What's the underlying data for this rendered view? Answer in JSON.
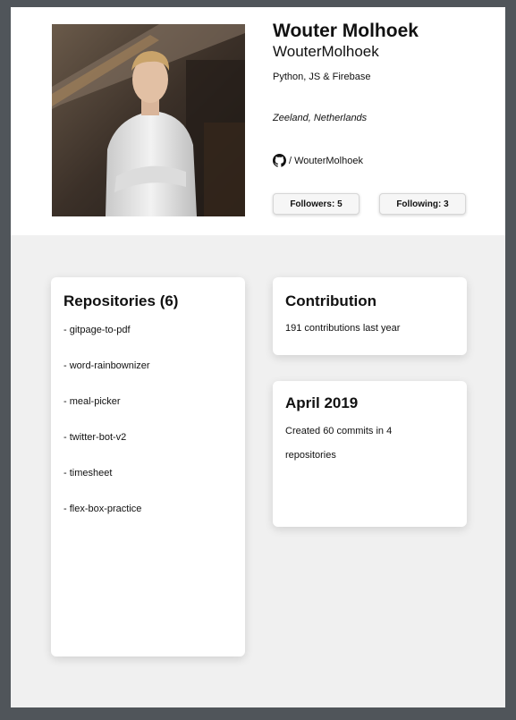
{
  "profile": {
    "name": "Wouter Molhoek",
    "username": "WouterMolhoek",
    "skills": "Python, JS & Firebase",
    "location": "Zeeland, Netherlands",
    "github_link": "/ WouterMolhoek",
    "followers_label": "Followers: 5",
    "following_label": "Following: 3"
  },
  "repositories": {
    "title": "Repositories (6)",
    "items": [
      "- gitpage-to-pdf",
      "- word-rainbownizer",
      "- meal-picker",
      "- twitter-bot-v2",
      "- timesheet",
      "- flex-box-practice"
    ]
  },
  "contribution": {
    "title": "Contribution",
    "text": "191 contributions last year"
  },
  "month_card": {
    "title": "April 2019",
    "line1": "Created 60 commits in 4",
    "line2": "repositories"
  },
  "icons": {
    "github": "github-icon"
  },
  "colors": {
    "frame": "#50555a",
    "page_background": "#f0f0f0",
    "card": "#ffffff"
  }
}
